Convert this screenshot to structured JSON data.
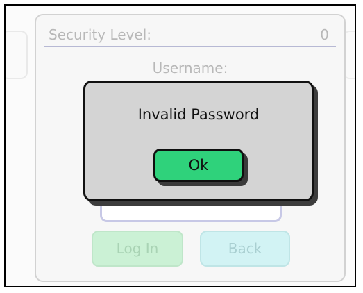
{
  "background_panel": {
    "security_level_label": "Security Level:",
    "security_level_value": "0",
    "username_label": "Username:",
    "login_button_label": "Log In",
    "back_button_label": "Back"
  },
  "dialog": {
    "message": "Invalid Password",
    "ok_label": "Ok"
  },
  "colors": {
    "ok_button": "#2fd27b",
    "dialog_background": "#d4d4d4",
    "login_button_disabled": "#cbf1d5",
    "back_button_disabled": "#d2f3f4",
    "divider": "#b7b9d4"
  }
}
